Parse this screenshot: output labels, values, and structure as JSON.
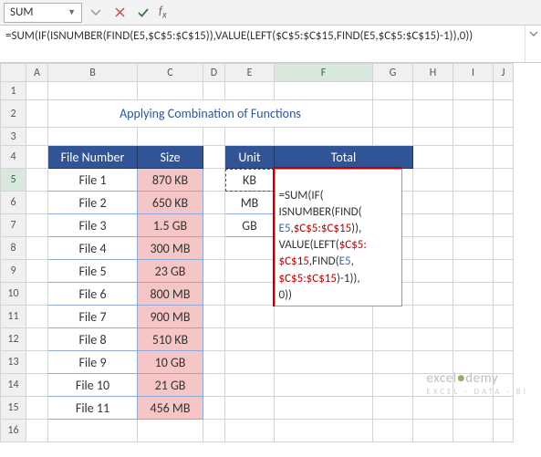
{
  "name_box": "SUM",
  "formula_bar": "=SUM(IF(ISNUMBER(FIND(E5,$C$5:$C$15)),VALUE(LEFT($C$5:$C$15,FIND(E5,$C$5:$C$15)-1)),0))",
  "title": "Applying Combination of Functions",
  "headers": {
    "file_number": "File Number",
    "size": "Size",
    "unit": "Unit",
    "total": "Total"
  },
  "columns": [
    "A",
    "B",
    "C",
    "D",
    "E",
    "F",
    "G",
    "H",
    "I",
    "J"
  ],
  "rows": [
    {
      "n": 1
    },
    {
      "n": 2
    },
    {
      "n": 3
    },
    {
      "n": 4
    },
    {
      "n": 5,
      "file": "File 1",
      "size": "870 KB",
      "unit": "KB"
    },
    {
      "n": 6,
      "file": "File 2",
      "size": "650 KB",
      "unit": "MB"
    },
    {
      "n": 7,
      "file": "File 3",
      "size": "1.5 GB",
      "unit": "GB"
    },
    {
      "n": 8,
      "file": "File 4",
      "size": "300 MB"
    },
    {
      "n": 9,
      "file": "File 5",
      "size": "23 GB"
    },
    {
      "n": 10,
      "file": "File 6",
      "size": "800 MB"
    },
    {
      "n": 11,
      "file": "File 7",
      "size": "900 MB"
    },
    {
      "n": 12,
      "file": "File 8",
      "size": "510 KB"
    },
    {
      "n": 13,
      "file": "File 9",
      "size": "10 GB"
    },
    {
      "n": 14,
      "file": "File 10",
      "size": "21 GB"
    },
    {
      "n": 15,
      "file": "File 11",
      "size": "456 MB"
    },
    {
      "n": 16
    }
  ],
  "edit_tokens": {
    "l1a": "=SUM(",
    "l1b": "IF(",
    "l2a": "ISNUMBER(",
    "l2b": "FIND(",
    "l3a": "E5",
    "l3b": ",",
    "l3c": "$C$5:$C$15",
    "l3d": ")),",
    "l4a": "VALUE(",
    "l4b": "LEFT(",
    "l4c": "$C$5:",
    "l5a": "$C$15",
    "l5b": ",",
    "l5c": "FIND(",
    "l5d": "E5",
    "l5e": ",",
    "l6a": "$C$5:$C$15",
    "l6b": ")-",
    "l6c": "1",
    "l6d": ")),",
    "l7a": "0",
    "l7b": "))"
  },
  "watermark": {
    "brand_a": "excel",
    "brand_b": "demy",
    "sub": "EXCEL · DATA · BI"
  }
}
